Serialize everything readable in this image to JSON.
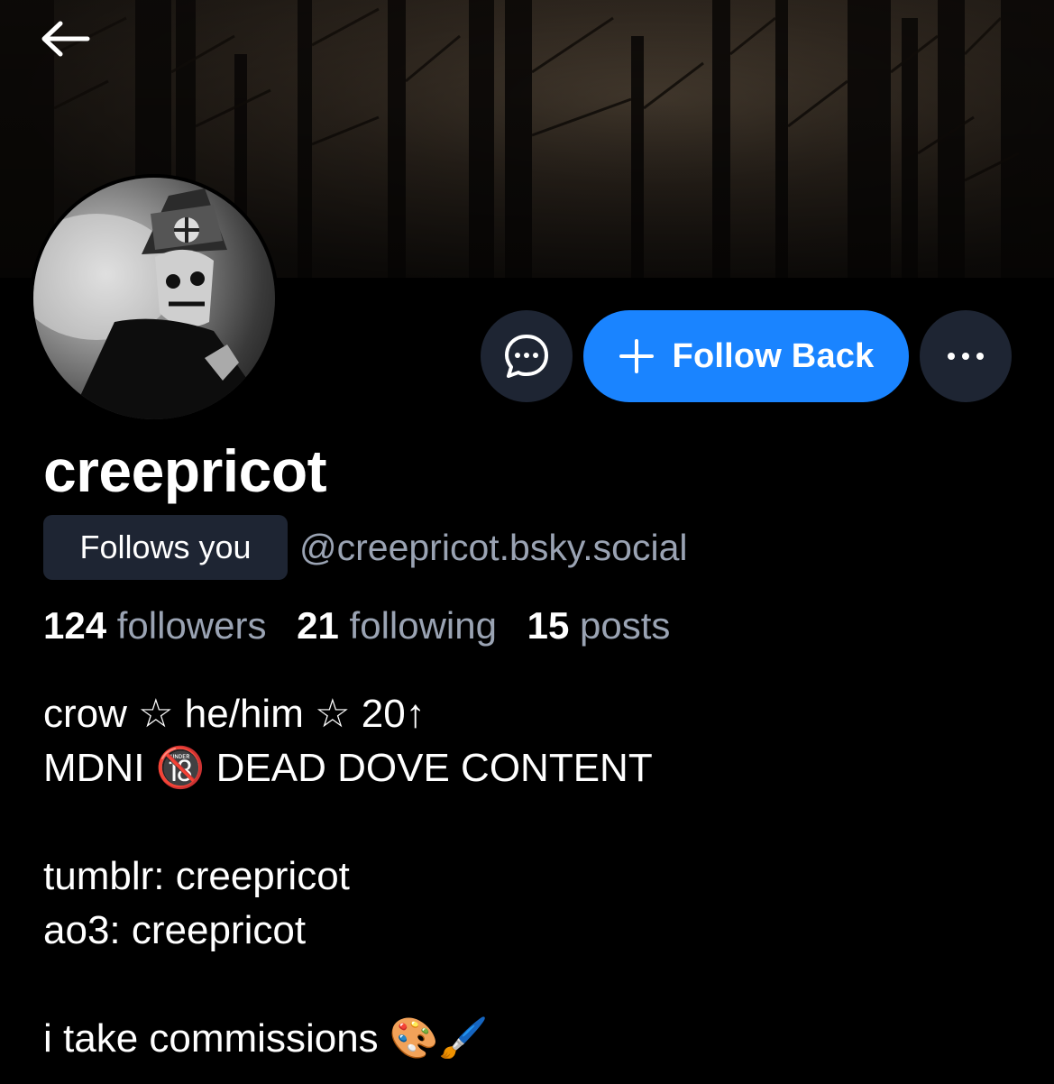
{
  "header": {
    "back_icon": "arrow-left-icon"
  },
  "profile": {
    "display_name": "creepricot",
    "follows_you_badge": "Follows you",
    "handle": "@creepricot.bsky.social",
    "stats": [
      {
        "count": "124",
        "label": "followers"
      },
      {
        "count": "21",
        "label": "following"
      },
      {
        "count": "15",
        "label": "posts"
      }
    ],
    "bio_lines": [
      "crow ☆ he/him ☆ 20↑",
      "MDNI 🔞 DEAD DOVE CONTENT",
      "",
      "tumblr: creepricot",
      "ao3: creepricot",
      "",
      "i take commissions 🎨🖌️"
    ]
  },
  "actions": {
    "message_icon": "chat-bubble-icon",
    "follow_back_label": "Follow Back",
    "follow_icon": "plus-icon",
    "more_icon": "ellipsis-icon"
  },
  "colors": {
    "background": "#000000",
    "accent": "#1a84ff",
    "button_dark": "#1e2533",
    "muted_text": "#9aa3b3"
  }
}
